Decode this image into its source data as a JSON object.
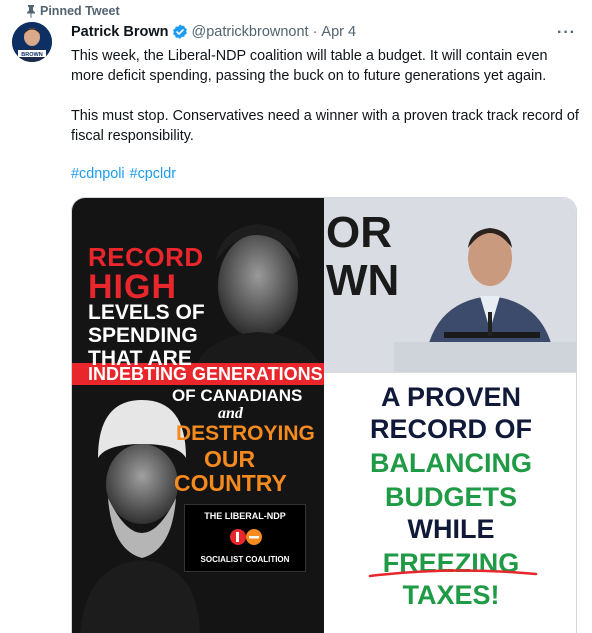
{
  "pinned": {
    "label": "Pinned Tweet"
  },
  "tweet": {
    "author": {
      "name": "Patrick Brown",
      "handle": "@patrickbrownont",
      "date": "Apr 4",
      "avatar_text": "BROWN"
    },
    "paragraphs": [
      "This week, the Liberal-NDP coalition will table a budget. It will contain even more deficit spending, passing the buck on to future generations yet again.",
      "This must stop. Conservatives need a winner with a proven track track record of fiscal responsibility."
    ],
    "hashtags": [
      "#cdnpoli",
      "#cpcldr"
    ],
    "more_label": "···"
  },
  "media": {
    "left_panel": {
      "lines": [
        "RECORD",
        "HIGH",
        "LEVELS OF",
        "SPENDING",
        "THAT ARE",
        "INDEBTING GENERATIONS",
        "OF CANADIANS",
        "and",
        "DESTROYING",
        "OUR",
        "COUNTRY"
      ],
      "coalition_box": {
        "line1": "THE LIBERAL-NDP",
        "line2": "SOCIALIST COALITION"
      }
    },
    "right_panel": {
      "background_text": [
        "OR",
        "WN"
      ],
      "lines": [
        "A PROVEN",
        "RECORD OF",
        "BALANCING",
        "BUDGETS",
        "WHILE",
        "FREEZING",
        "TAXES!"
      ]
    }
  },
  "colors": {
    "accent_blue": "#1d9bf0",
    "ad_red": "#e8262c",
    "ad_orange": "#f58a1f",
    "ad_green": "#1f9a45",
    "ad_navy": "#101a38"
  }
}
